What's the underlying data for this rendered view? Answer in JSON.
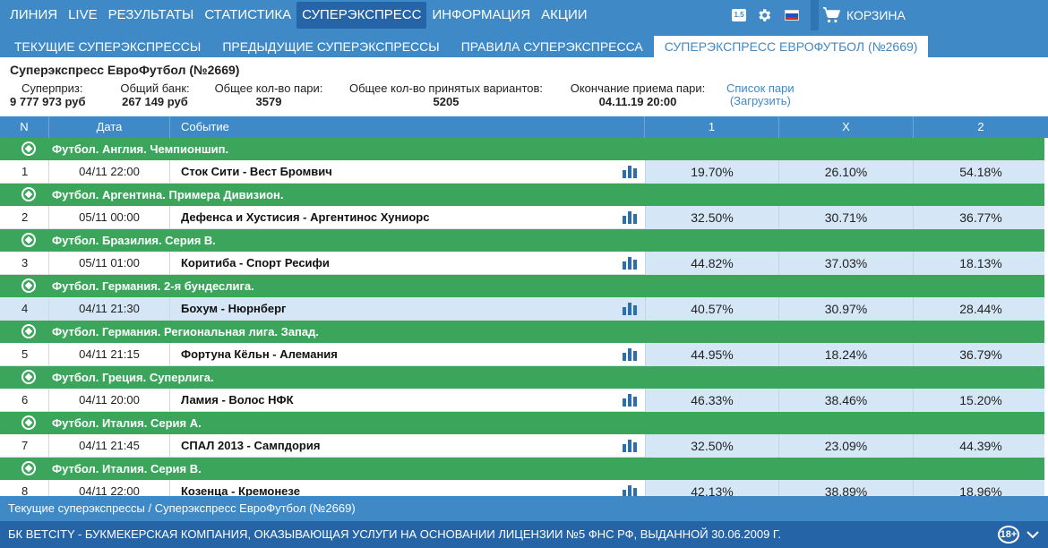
{
  "nav": {
    "items": [
      {
        "label": "ЛИНИЯ",
        "active": false
      },
      {
        "label": "LIVE",
        "active": false
      },
      {
        "label": "РЕЗУЛЬТАТЫ",
        "active": false
      },
      {
        "label": "СТАТИСТИКА",
        "active": false
      },
      {
        "label": "СУПЕРЭКСПРЕСС",
        "active": true
      },
      {
        "label": "ИНФОРМАЦИЯ",
        "active": false
      },
      {
        "label": "АКЦИИ",
        "active": false
      }
    ],
    "odds_format": "1.5",
    "icons": [
      "odds-format-icon",
      "gear-icon",
      "flag-ru-icon"
    ],
    "cart_label": "КОРЗИНА"
  },
  "subtabs": [
    {
      "label": "ТЕКУЩИЕ СУПЕРЭКСПРЕССЫ",
      "active": false
    },
    {
      "label": "ПРЕДЫДУЩИЕ СУПЕРЭКСПРЕССЫ",
      "active": false
    },
    {
      "label": "ПРАВИЛА СУПЕРЭКСПРЕССА",
      "active": false
    },
    {
      "label": "СУПЕРЭКСПРЕСС ЕВРОФУТБОЛ (№2669)",
      "active": true
    }
  ],
  "info": {
    "title": "Суперэкспресс ЕвроФутбол (№2669)",
    "superprize_label": "Суперприз:",
    "superprize_value": "9 777 973 руб",
    "bank_label": "Общий банк:",
    "bank_value": "267 149 руб",
    "bets_label": "Общее кол-во пари:",
    "bets_value": "3579",
    "variants_label": "Общее кол-во принятых вариантов:",
    "variants_value": "5205",
    "end_label": "Окончание приема пари:",
    "end_value": "04.11.19 20:00",
    "pari_list_label": "Список пари",
    "pari_load_label": "(Загрузить)"
  },
  "table": {
    "headers": {
      "n": "N",
      "date": "Дата",
      "event": "Событие",
      "p1": "1",
      "px": "X",
      "p2": "2"
    },
    "groups": [
      {
        "league": "Футбол. Англия. Чемпионшип.",
        "n": "1",
        "date": "04/11 22:00",
        "event": "Сток Сити - Вест Бромвич",
        "p1": "19.70%",
        "px": "26.10%",
        "p2": "54.18%",
        "highlight": false
      },
      {
        "league": "Футбол. Аргентина. Примера Дивизион.",
        "n": "2",
        "date": "05/11 00:00",
        "event": "Дефенса и Хустисия - Аргентинос Хуниорс",
        "p1": "32.50%",
        "px": "30.71%",
        "p2": "36.77%",
        "highlight": false
      },
      {
        "league": "Футбол. Бразилия. Серия B.",
        "n": "3",
        "date": "05/11 01:00",
        "event": "Коритиба - Спорт Ресифи",
        "p1": "44.82%",
        "px": "37.03%",
        "p2": "18.13%",
        "highlight": false
      },
      {
        "league": "Футбол. Германия. 2-я бундеслига.",
        "n": "4",
        "date": "04/11 21:30",
        "event": "Бохум - Нюрнберг",
        "p1": "40.57%",
        "px": "30.97%",
        "p2": "28.44%",
        "highlight": true
      },
      {
        "league": "Футбол. Германия. Региональная лига. Запад.",
        "n": "5",
        "date": "04/11 21:15",
        "event": "Фортуна Кёльн - Алемания",
        "p1": "44.95%",
        "px": "18.24%",
        "p2": "36.79%",
        "highlight": false
      },
      {
        "league": "Футбол. Греция. Суперлига.",
        "n": "6",
        "date": "04/11 20:00",
        "event": "Ламия - Волос НФК",
        "p1": "46.33%",
        "px": "38.46%",
        "p2": "15.20%",
        "highlight": false
      },
      {
        "league": "Футбол. Италия. Серия А.",
        "n": "7",
        "date": "04/11 21:45",
        "event": "СПАЛ 2013 - Сампдория",
        "p1": "32.50%",
        "px": "23.09%",
        "p2": "44.39%",
        "highlight": false
      },
      {
        "league": "Футбол. Италия. Серия B.",
        "n": "8",
        "date": "04/11 22:00",
        "event": "Козенца - Кремонезе",
        "p1": "42.13%",
        "px": "38.89%",
        "p2": "18.96%",
        "highlight": false
      }
    ]
  },
  "breadcrumb": "Текущие суперэкспрессы / Суперэкспресс ЕвроФутбол (№2669)",
  "footer": {
    "text": "БК BETCITY - БУКМЕКЕРСКАЯ КОМПАНИЯ, ОКАЗЫВАЮЩАЯ УСЛУГИ НА ОСНОВАНИИ ЛИЦЕНЗИИ №5 ФНС РФ, ВЫДАННОЙ 30.06.2009 Г.",
    "age": "18+"
  },
  "colors": {
    "nav": "#3f89c6",
    "nav_active": "#2565a7",
    "league": "#3ba65b",
    "highlight": "#d5e7f6",
    "footer": "#2565a7"
  }
}
